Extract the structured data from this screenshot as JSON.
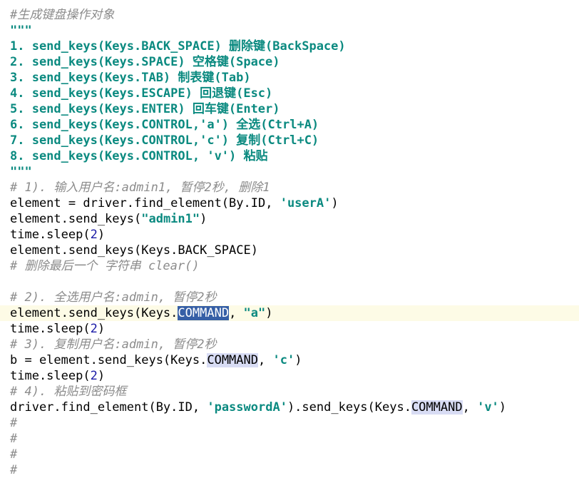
{
  "editor": {
    "lines": [
      {
        "type": "comment",
        "text": "#生成键盘操作对象"
      },
      {
        "type": "docstring",
        "text": "\"\"\""
      },
      {
        "type": "docstring",
        "text": "1. send_keys(Keys.BACK_SPACE) 删除键(BackSpace)"
      },
      {
        "type": "docstring",
        "text": "2. send_keys(Keys.SPACE) 空格键(Space)"
      },
      {
        "type": "docstring",
        "text": "3. send_keys(Keys.TAB) 制表键(Tab)"
      },
      {
        "type": "docstring",
        "text": "4. send_keys(Keys.ESCAPE) 回退键(Esc)"
      },
      {
        "type": "docstring",
        "text": "5. send_keys(Keys.ENTER) 回车键(Enter)"
      },
      {
        "type": "docstring",
        "text": "6. send_keys(Keys.CONTROL,'a') 全选(Ctrl+A)"
      },
      {
        "type": "docstring",
        "text": "7. send_keys(Keys.CONTROL,'c') 复制(Ctrl+C)"
      },
      {
        "type": "docstring",
        "text": "8. send_keys(Keys.CONTROL, 'v') 粘贴"
      },
      {
        "type": "docstring",
        "text": "\"\"\""
      },
      {
        "type": "comment",
        "text": "# 1). 输入用户名:admin1, 暂停2秒, 删除1"
      },
      {
        "type": "code",
        "parts": [
          {
            "t": "element = driver.find_element(By.ID, "
          },
          {
            "t": "'userA'",
            "c": "str"
          },
          {
            "t": ")"
          }
        ]
      },
      {
        "type": "code",
        "parts": [
          {
            "t": "element.send_keys("
          },
          {
            "t": "\"admin1\"",
            "c": "str"
          },
          {
            "t": ")"
          }
        ]
      },
      {
        "type": "code",
        "parts": [
          {
            "t": "time.sleep("
          },
          {
            "t": "2",
            "c": "num"
          },
          {
            "t": ")"
          }
        ]
      },
      {
        "type": "code",
        "parts": [
          {
            "t": "element.send_keys(Keys.BACK_SPACE)"
          }
        ]
      },
      {
        "type": "comment",
        "text": "# 删除最后一个 字符串 clear()"
      },
      {
        "type": "blank",
        "text": ""
      },
      {
        "type": "comment",
        "text": "# 2). 全选用户名:admin, 暂停2秒"
      },
      {
        "type": "code",
        "current": true,
        "parts": [
          {
            "t": "element.send_keys(Keys."
          },
          {
            "t": "COMMAND",
            "c": "sel"
          },
          {
            "t": ", "
          },
          {
            "t": "\"a\"",
            "c": "str"
          },
          {
            "t": ")"
          }
        ]
      },
      {
        "type": "code",
        "parts": [
          {
            "t": "time.sleep("
          },
          {
            "t": "2",
            "c": "num"
          },
          {
            "t": ")"
          }
        ]
      },
      {
        "type": "comment",
        "text": "# 3). 复制用户名:admin, 暂停2秒"
      },
      {
        "type": "code",
        "parts": [
          {
            "t": "b = element.send_keys(Keys."
          },
          {
            "t": "COMMAND",
            "c": "hl"
          },
          {
            "t": ", "
          },
          {
            "t": "'c'",
            "c": "str"
          },
          {
            "t": ")"
          }
        ]
      },
      {
        "type": "code",
        "parts": [
          {
            "t": "time.sleep("
          },
          {
            "t": "2",
            "c": "num"
          },
          {
            "t": ")"
          }
        ]
      },
      {
        "type": "comment",
        "text": "# 4). 粘贴到密码框"
      },
      {
        "type": "code",
        "parts": [
          {
            "t": "driver.find_element(By.ID, "
          },
          {
            "t": "'passwordA'",
            "c": "str"
          },
          {
            "t": ").send_keys(Keys."
          },
          {
            "t": "COMMAND",
            "c": "hl"
          },
          {
            "t": ", "
          },
          {
            "t": "'v'",
            "c": "str"
          },
          {
            "t": ")"
          }
        ]
      },
      {
        "type": "comment",
        "text": "#"
      },
      {
        "type": "comment",
        "text": "#"
      },
      {
        "type": "comment",
        "text": "#"
      },
      {
        "type": "comment",
        "text": "#"
      }
    ]
  }
}
